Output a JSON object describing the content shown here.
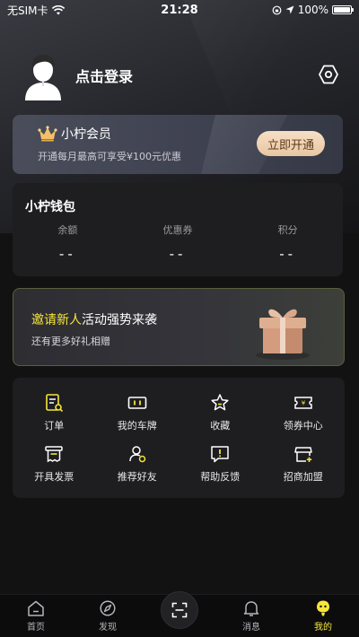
{
  "status_bar": {
    "carrier": "无SIM卡",
    "time": "21:28",
    "battery": "100%"
  },
  "profile": {
    "login_text": "点击登录"
  },
  "member": {
    "title": "小柠会员",
    "description": "开通每月最高可享受¥100元优惠",
    "button_label": "立即开通"
  },
  "wallet": {
    "title": "小柠钱包",
    "items": [
      {
        "label": "余额",
        "value": "--"
      },
      {
        "label": "优惠券",
        "value": "--"
      },
      {
        "label": "积分",
        "value": "--"
      }
    ]
  },
  "invite": {
    "title_highlight": "邀请新人",
    "title_rest": "活动强势来袭",
    "subtitle": "还有更多好礼相赠"
  },
  "grid": {
    "items": [
      {
        "label": "订单",
        "icon": "order-icon"
      },
      {
        "label": "我的车牌",
        "icon": "license-plate-icon"
      },
      {
        "label": "收藏",
        "icon": "star-icon"
      },
      {
        "label": "领券中心",
        "icon": "coupon-icon"
      },
      {
        "label": "开具发票",
        "icon": "invoice-icon"
      },
      {
        "label": "推荐好友",
        "icon": "recommend-friend-icon"
      },
      {
        "label": "帮助反馈",
        "icon": "feedback-icon"
      },
      {
        "label": "招商加盟",
        "icon": "franchise-icon"
      }
    ]
  },
  "tab_bar": {
    "items": [
      {
        "label": "首页",
        "icon": "home-icon"
      },
      {
        "label": "发现",
        "icon": "discover-icon"
      },
      {
        "label": "",
        "icon": "scan-icon"
      },
      {
        "label": "消息",
        "icon": "bell-icon"
      },
      {
        "label": "我的",
        "icon": "mine-icon"
      }
    ],
    "active": "我的"
  },
  "colors": {
    "accent_yellow": "#f5e63a",
    "gold_button": "#e8c6a2",
    "background": "#121212",
    "card": "#1e1e20"
  }
}
